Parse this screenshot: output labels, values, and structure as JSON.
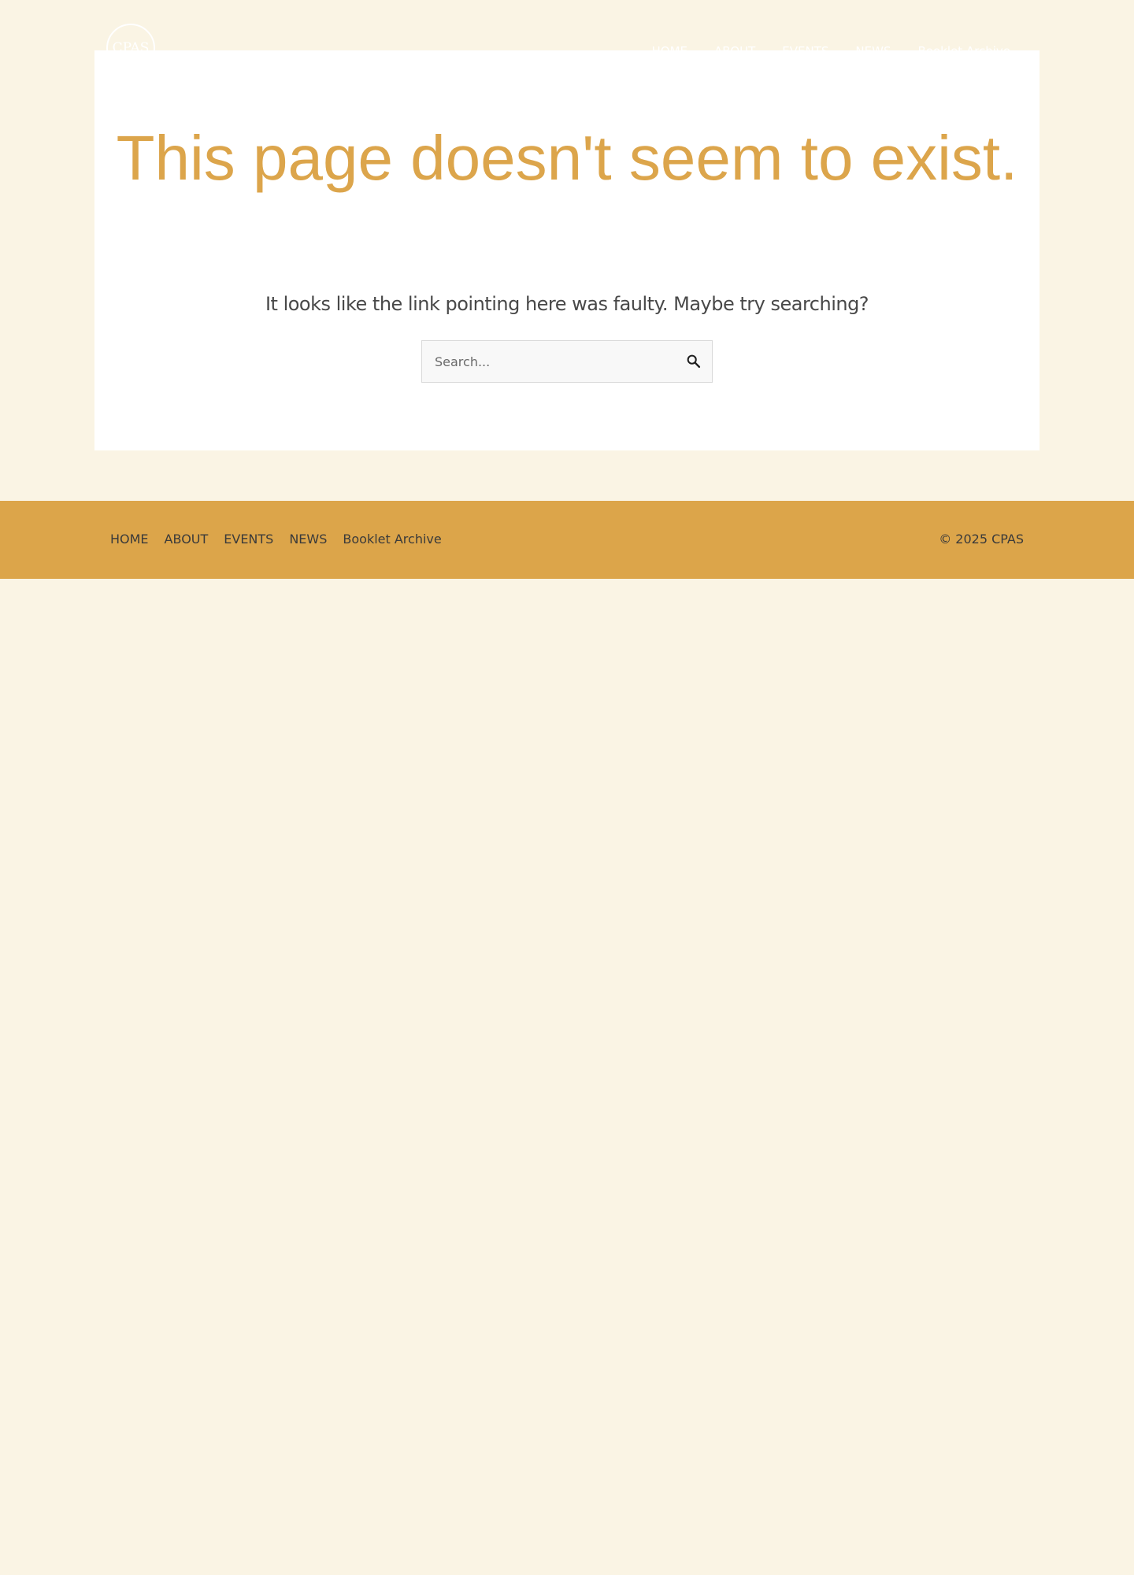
{
  "header": {
    "logo_text": "CPAS",
    "nav": [
      "HOME",
      "ABOUT",
      "EVENTS",
      "NEWS",
      "Booklet Archive"
    ]
  },
  "main": {
    "title": "This page doesn't seem to exist.",
    "subtitle": "It looks like the link pointing here was faulty. Maybe try searching?",
    "search": {
      "placeholder": "Search...",
      "value": "",
      "button_icon": "search-icon"
    }
  },
  "footer": {
    "nav": [
      "HOME",
      "ABOUT",
      "EVENTS",
      "NEWS",
      "Booklet Archive"
    ],
    "copyright": "© 2025 CPAS"
  },
  "colors": {
    "page_background": "#faf4e4",
    "accent": "#dca54a",
    "text": "#484848",
    "nav_text": "#ffffff"
  }
}
